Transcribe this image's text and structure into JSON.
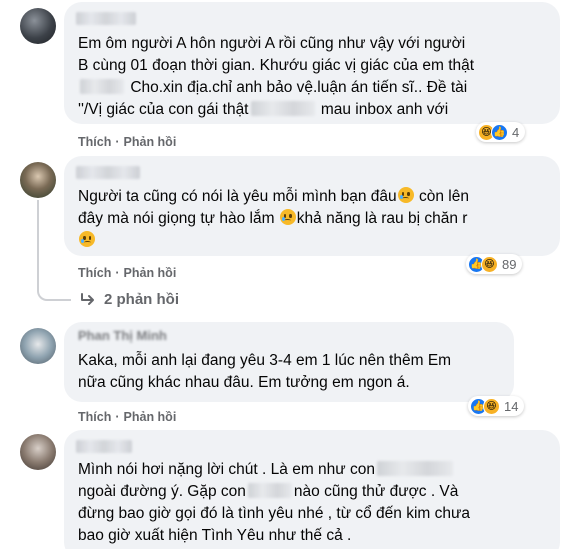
{
  "comments": [
    {
      "lines": [
        [
          "Em ôm người A hôn người A rồi cũng như vậy với người"
        ],
        [
          "B cùng 01 đoạn thời gian. Khướu giác vị giác của em thật"
        ],
        [
          "",
          "Cho.xin địa.chỉ anh bảo vệ.luận án tiến sĩ.. Đề tài"
        ],
        [
          "''/Vị giác của con gái thật",
          "mau inbox anh với"
        ]
      ],
      "actions": {
        "like": "Thích",
        "reply": "Phản hồi"
      },
      "reaction_count": "4"
    },
    {
      "lines": [
        [
          "Người ta cũng có nói là yêu mỗi mình bạn đâu",
          " còn lên"
        ],
        [
          "đây mà nói giọng tự hào lắm ",
          "khả năng là rau bị chăn r"
        ],
        [
          ""
        ]
      ],
      "actions": {
        "like": "Thích",
        "reply": "Phản hồi"
      },
      "reaction_count": "89",
      "replies_label": "2 phản hồi"
    },
    {
      "name_partial": "Phan Thị Minh",
      "lines": [
        [
          "Kaka, mỗi anh lại đang yêu 3-4 em 1 lúc nên thêm Em"
        ],
        [
          "nữa cũng khác nhau đâu. Em tưởng em ngon á."
        ]
      ],
      "actions": {
        "like": "Thích",
        "reply": "Phản hồi"
      },
      "reaction_count": "14"
    },
    {
      "lines": [
        [
          "Mình nói hơi nặng lời chút . Là em như con"
        ],
        [
          "ngoài đường ý. Gặp con",
          "nào cũng thử được . Và"
        ],
        [
          "đừng bao giờ gọi đó là tình yêu nhé , từ cổ đến kim chưa"
        ],
        [
          "bao giờ xuất hiện Tình Yêu như thế cả ."
        ]
      ]
    }
  ],
  "icons": [
    "haha-icon",
    "like-icon",
    "sad-emoji-icon",
    "reply-arrow-icon"
  ],
  "colors": {
    "bubble": "#f0f2f5",
    "meta_text": "#65676b",
    "like_blue": "#1877f2",
    "haha_yellow": "#f7b125"
  }
}
